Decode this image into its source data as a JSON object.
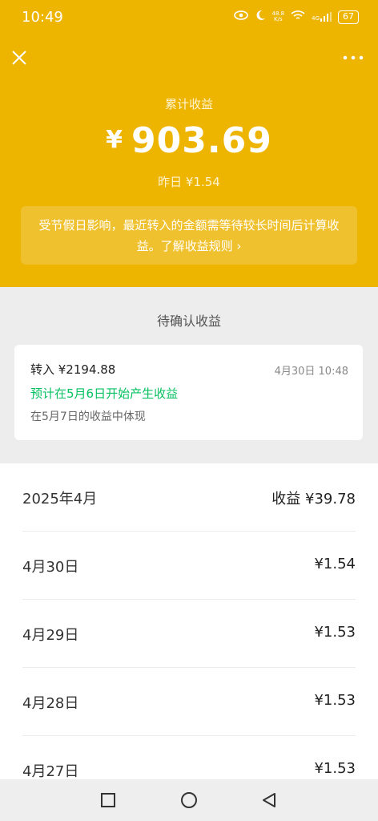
{
  "status_bar": {
    "time": "10:49",
    "net_speed_top": "48.8",
    "net_speed_unit": "K/s",
    "signal": "4G",
    "battery": "67"
  },
  "header": {
    "total_label": "累计收益",
    "currency": "¥",
    "total_amount": "903.69",
    "yesterday": "昨日 ¥1.54",
    "notice": "受节假日影响，最近转入的金额需等待较长时间后计算收益。了解收益规则 ›"
  },
  "pending": {
    "title": "待确认收益",
    "amount": "转入 ¥2194.88",
    "time": "4月30日 10:48",
    "expect": "预计在5月6日开始产生收益",
    "show": "在5月7日的收益中体现"
  },
  "earnings": {
    "rows": [
      {
        "left": "2025年4月",
        "right": "收益 ¥39.78"
      },
      {
        "left": "4月30日",
        "right": "¥1.54"
      },
      {
        "left": "4月29日",
        "right": "¥1.53"
      },
      {
        "left": "4月28日",
        "right": "¥1.53"
      },
      {
        "left": "4月27日",
        "right": "¥1.53"
      }
    ]
  }
}
